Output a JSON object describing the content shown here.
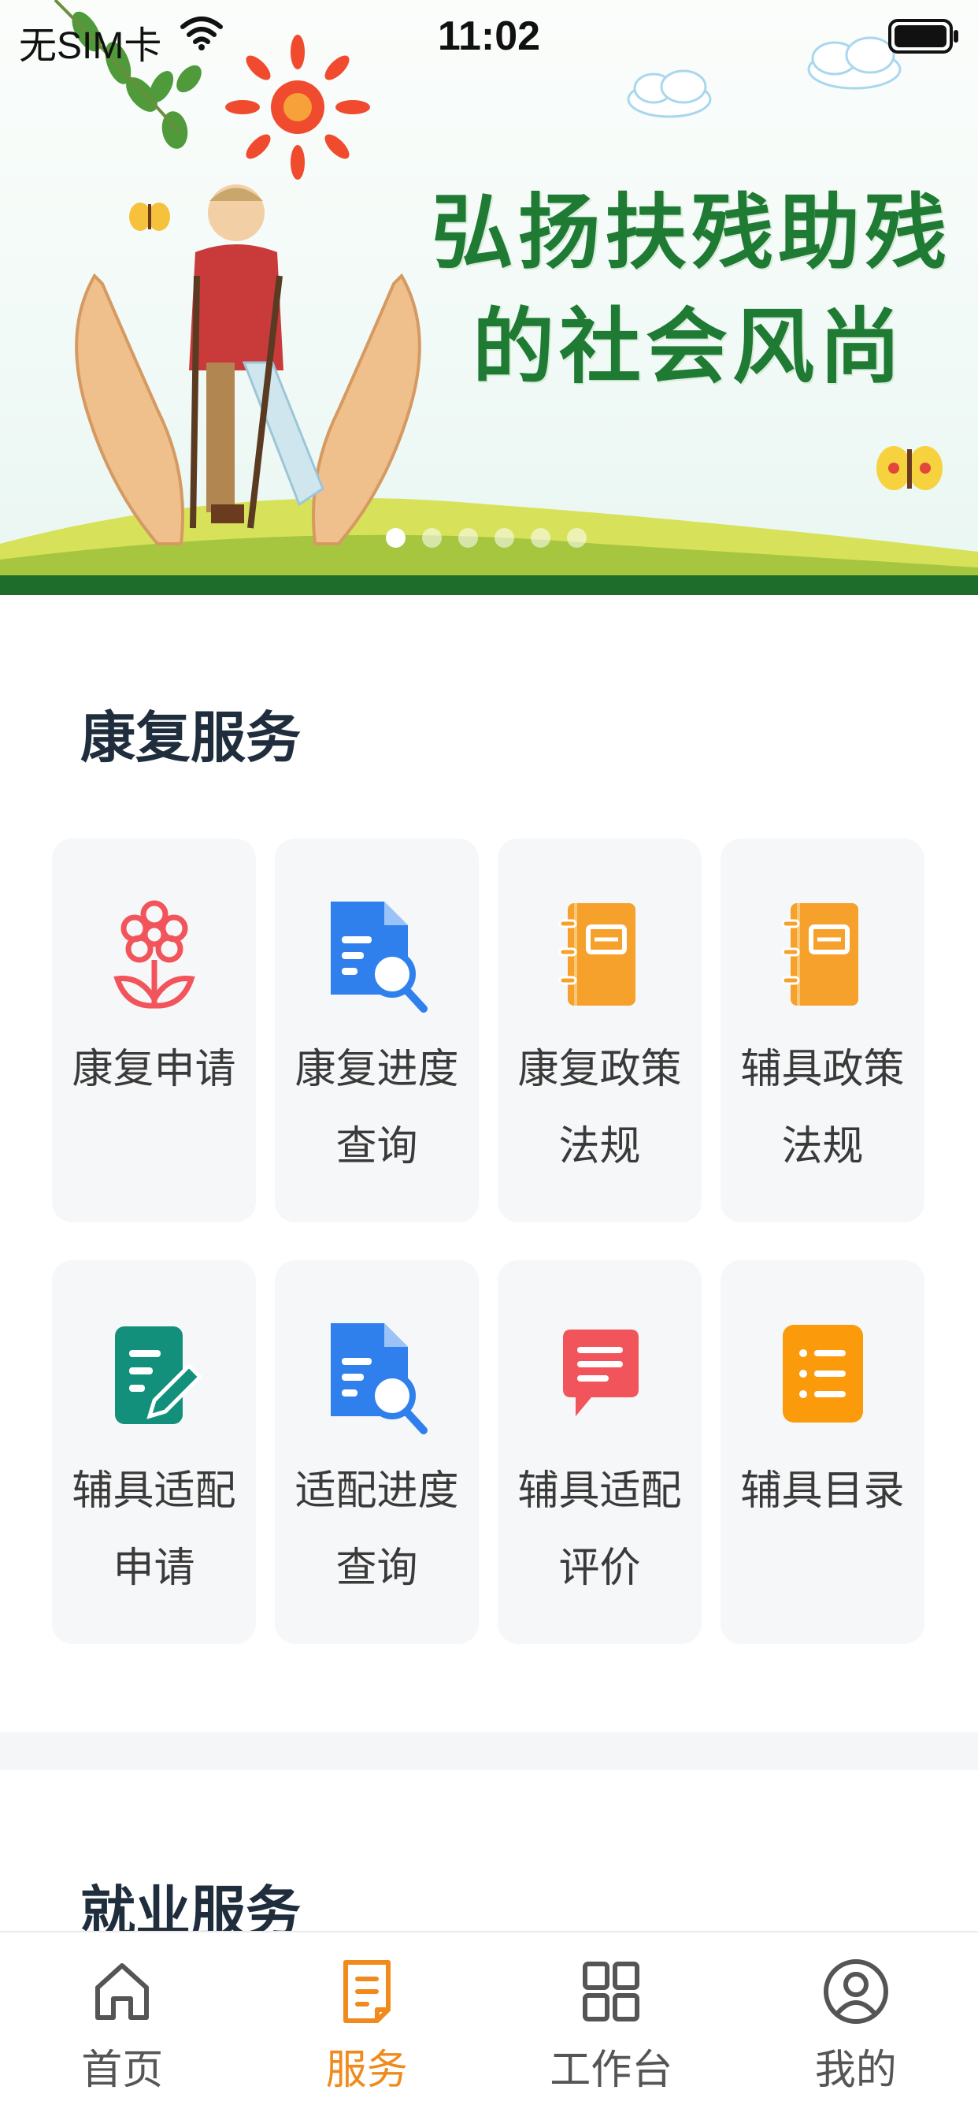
{
  "status_bar": {
    "carrier": "无SIM卡",
    "time": "11:02"
  },
  "banner": {
    "line1": "弘扬扶残助残",
    "line2": "的社会风尚",
    "slide_count": 6,
    "active_slide": 1
  },
  "rehab_section": {
    "title": "康复服务",
    "items": [
      {
        "label": "康复申请",
        "icon": "flower-icon",
        "color": "#f2545b"
      },
      {
        "label": "康复进度查询",
        "icon": "document-search-icon",
        "color": "#2f80ed"
      },
      {
        "label": "康复政策法规",
        "icon": "notebook-icon",
        "color": "#f5a12c"
      },
      {
        "label": "辅具政策法规",
        "icon": "notebook-icon",
        "color": "#f5a12c"
      },
      {
        "label": "辅具适配申请",
        "icon": "edit-document-icon",
        "color": "#13907c"
      },
      {
        "label": "适配进度查询",
        "icon": "document-search-icon",
        "color": "#2f80ed"
      },
      {
        "label": "辅具适配评价",
        "icon": "chat-bubble-icon",
        "color": "#f2545b"
      },
      {
        "label": "辅具目录",
        "icon": "list-icon",
        "color": "#fb9a0b"
      }
    ]
  },
  "employment_section": {
    "title": "就业服务"
  },
  "tab_bar": {
    "tabs": [
      {
        "label": "首页",
        "icon": "home-icon"
      },
      {
        "label": "服务",
        "icon": "service-document-icon",
        "active": true
      },
      {
        "label": "工作台",
        "icon": "grid-icon"
      },
      {
        "label": "我的",
        "icon": "user-icon"
      }
    ],
    "active_color": "#f08a1c",
    "inactive_color": "#555555"
  }
}
